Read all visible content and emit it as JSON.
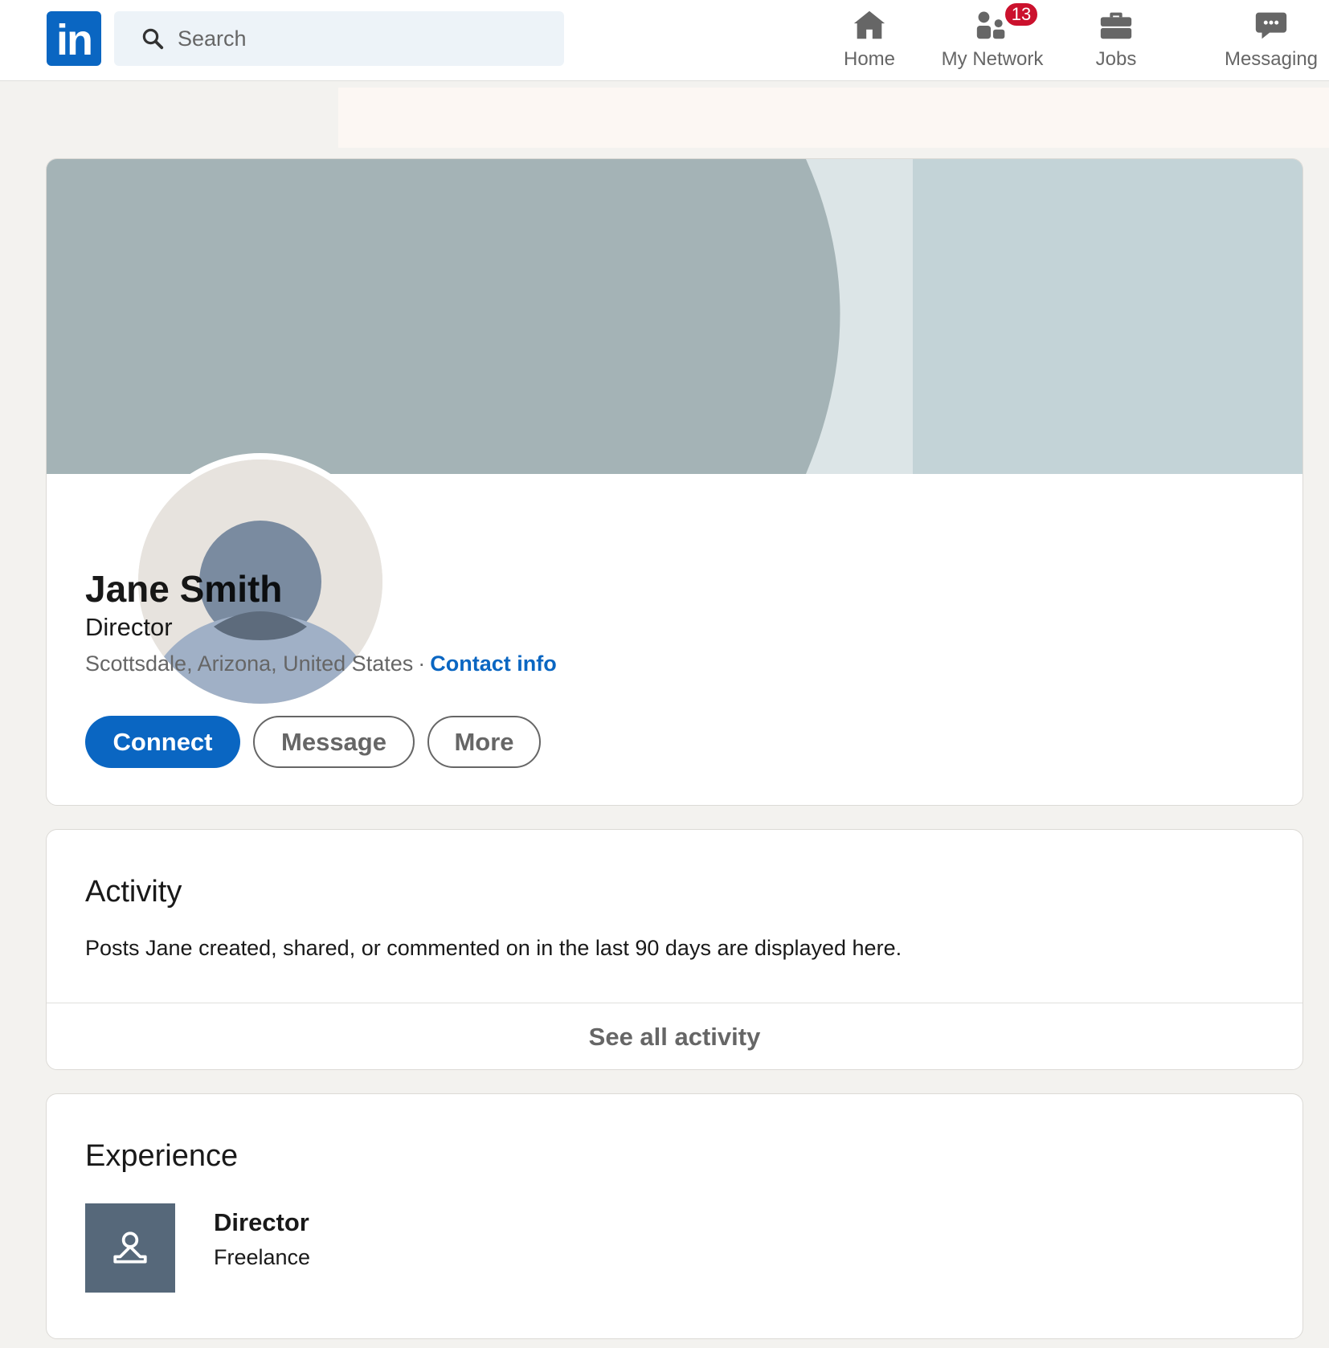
{
  "nav": {
    "logo_text": "in",
    "search": {
      "placeholder": "Search"
    },
    "items": [
      {
        "label": "Home",
        "icon": "home-icon"
      },
      {
        "label": "My Network",
        "icon": "people-icon",
        "badge": "13"
      },
      {
        "label": "Jobs",
        "icon": "briefcase-icon"
      },
      {
        "label": "Messaging",
        "icon": "chat-icon"
      }
    ]
  },
  "profile": {
    "name": "Jane Smith",
    "headline": "Director",
    "location": "Scottsdale, Arizona, United States",
    "separator": "·",
    "contact_info": "Contact info",
    "buttons": {
      "connect": "Connect",
      "message": "Message",
      "more": "More"
    }
  },
  "activity": {
    "title": "Activity",
    "description": "Posts Jane created, shared, or commented on in the last 90 days are displayed here.",
    "see_all": "See all activity"
  },
  "experience": {
    "title": "Experience",
    "items": [
      {
        "role": "Director",
        "company": "Freelance"
      }
    ]
  },
  "colors": {
    "brand": "#0a66c2",
    "badge": "#cb112d",
    "cover_dark": "#a4b3b6",
    "cover_light": "#c3d3d7",
    "page_background": "#f3f2ef"
  }
}
